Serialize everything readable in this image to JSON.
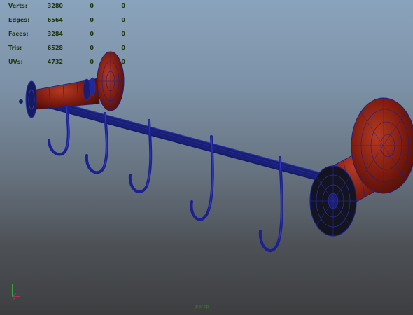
{
  "viewport": {
    "name": "3D Perspective Viewport",
    "colors": {
      "bg_top": "#8aa3bc",
      "bg_bottom": "#3d3e40",
      "wireframe": "#1a1f8a",
      "surface_red": "#8a1e10",
      "surface_black": "#141420",
      "hud_text": "#1e3410"
    }
  },
  "hud": {
    "rows": [
      {
        "label": "Verts:",
        "values": [
          "3280",
          "0",
          "0"
        ]
      },
      {
        "label": "Edges:",
        "values": [
          "6564",
          "0",
          "0"
        ]
      },
      {
        "label": "Faces:",
        "values": [
          "3284",
          "0",
          "0"
        ]
      },
      {
        "label": "Tris:",
        "values": [
          "6528",
          "0",
          "0"
        ]
      },
      {
        "label": "UVs:",
        "values": [
          "4732",
          "0",
          "0"
        ]
      }
    ]
  },
  "axis_gizmo": {
    "icon": "axis-gizmo-icon"
  },
  "camera_label": "persp"
}
